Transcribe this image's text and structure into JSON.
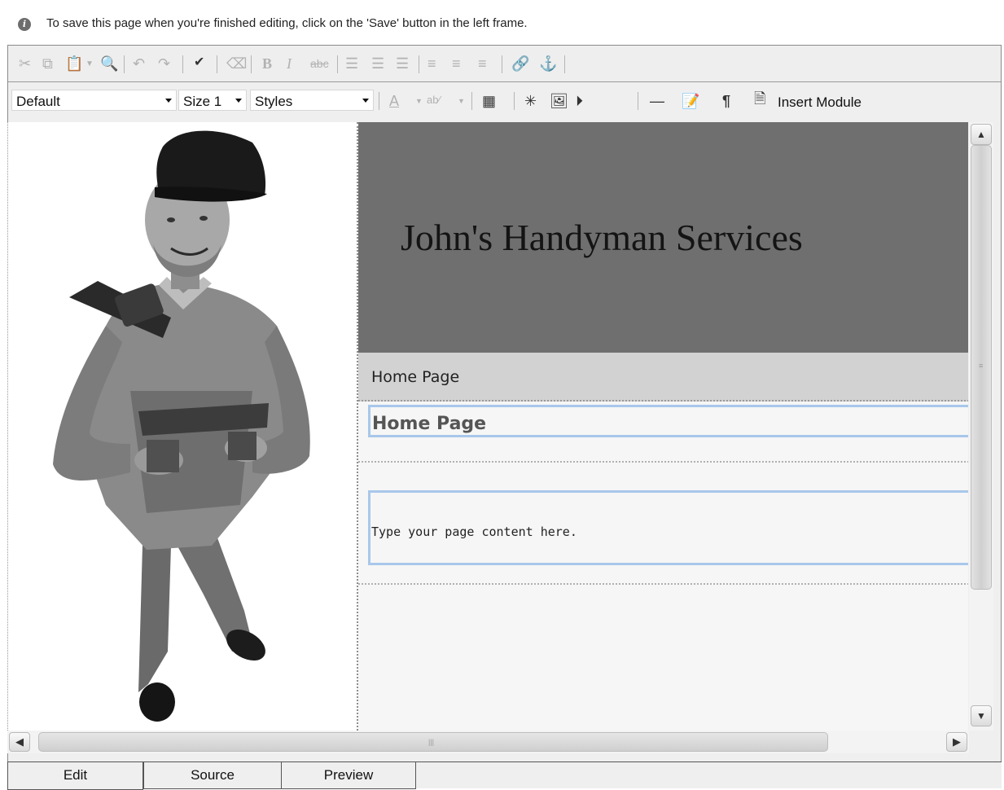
{
  "info_bar": {
    "message": "To save this page when you're finished editing, click on the 'Save' button in the left frame."
  },
  "toolbar_format": {
    "font_name": "Default",
    "font_size": "Size 1",
    "styles": "Styles",
    "insert_module_label": "Insert Module"
  },
  "page": {
    "site_title": "John's Handyman Services",
    "nav_item": "Home Page",
    "heading": "Home Page",
    "body_text": "Type your page content here."
  },
  "tabs": [
    {
      "label": "Edit",
      "active": true
    },
    {
      "label": "Source",
      "active": false
    },
    {
      "label": "Preview",
      "active": false
    }
  ],
  "colors": {
    "banner": "#6f6f6f",
    "nav_bar": "#d2d2d2",
    "edit_region_border": "#a9c7ea"
  }
}
